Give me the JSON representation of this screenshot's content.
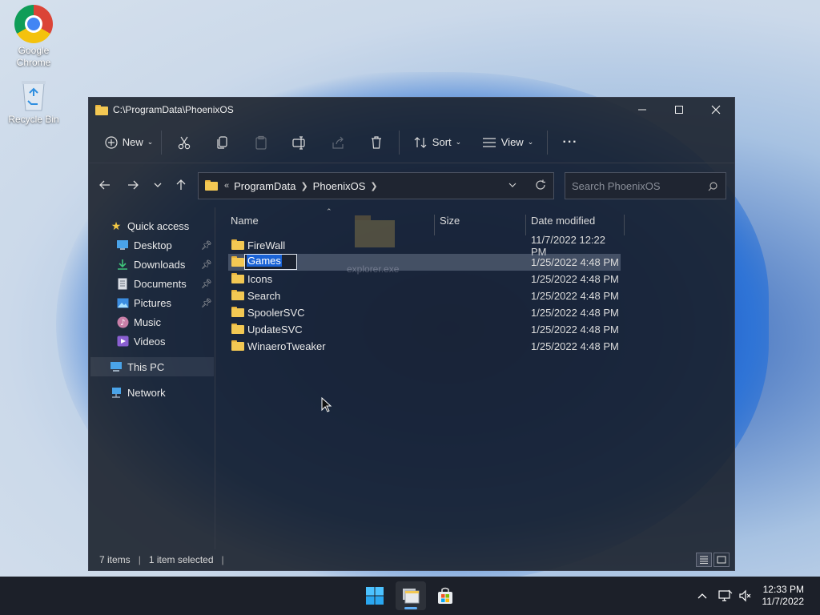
{
  "desktop": {
    "icons": [
      {
        "label_line1": "Google",
        "label_line2": "Chrome"
      },
      {
        "label": "Recycle Bin"
      }
    ]
  },
  "window": {
    "title": "C:\\ProgramData\\PhoenixOS",
    "controls": {
      "minimize": "minimize-icon",
      "maximize": "maximize-icon",
      "close": "close-icon"
    }
  },
  "toolbar": {
    "new_label": "New",
    "sort_label": "Sort",
    "view_label": "View",
    "more_label": "···"
  },
  "address": {
    "overflow": "«",
    "crumbs": [
      "ProgramData",
      "PhoenixOS"
    ]
  },
  "search": {
    "placeholder": "Search PhoenixOS"
  },
  "sidebar": {
    "quick_access": "Quick access",
    "items": [
      {
        "label": "Desktop",
        "pinned": true
      },
      {
        "label": "Downloads",
        "pinned": true
      },
      {
        "label": "Documents",
        "pinned": true
      },
      {
        "label": "Pictures",
        "pinned": true
      },
      {
        "label": "Music",
        "pinned": false
      },
      {
        "label": "Videos",
        "pinned": false
      }
    ],
    "this_pc": "This PC",
    "network": "Network"
  },
  "columns": {
    "name": "Name",
    "size": "Size",
    "date": "Date modified"
  },
  "files": [
    {
      "name": "FireWall",
      "date": "11/7/2022 12:22 PM"
    },
    {
      "name": "Games",
      "date": "1/25/2022 4:48 PM",
      "selected": true,
      "renaming": true
    },
    {
      "name": "Icons",
      "date": "1/25/2022 4:48 PM"
    },
    {
      "name": "Search",
      "date": "1/25/2022 4:48 PM"
    },
    {
      "name": "SpoolerSVC",
      "date": "1/25/2022 4:48 PM"
    },
    {
      "name": "UpdateSVC",
      "date": "1/25/2022 4:48 PM"
    },
    {
      "name": "WinaeroTweaker",
      "date": "1/25/2022 4:48 PM"
    }
  ],
  "drag_ghost": "explorer.exe",
  "status": {
    "items": "7 items",
    "selected": "1 item selected",
    "divider": "|"
  },
  "taskbar": {
    "time": "12:33 PM",
    "date": "11/7/2022",
    "accent": "#60aef5"
  }
}
